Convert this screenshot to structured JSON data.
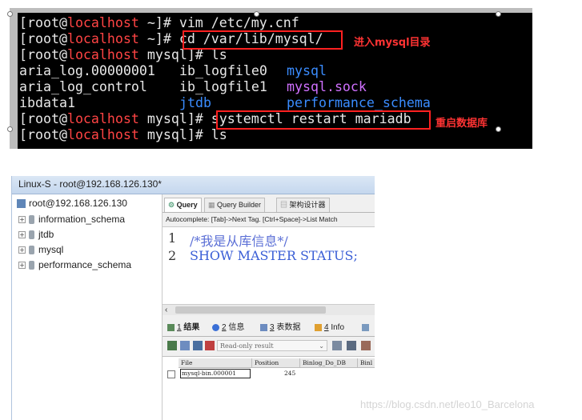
{
  "terminal": {
    "lines": [
      {
        "user": "[root@",
        "host": "localhost",
        "rest": " ~]# vim /etc/my.cnf"
      },
      {
        "user": "[root@",
        "host": "localhost",
        "rest": " ~]# ",
        "cmd": "cd /var/lib/mysql/"
      },
      {
        "user": "[root@",
        "host": "localhost",
        "rest": " mysql]# ls"
      },
      {
        "c1": "aria_log.00000001",
        "c2": "ib_logfile0",
        "c3": "mysql"
      },
      {
        "c1": "aria_log_control",
        "c2": "ib_logfile1",
        "c3": "mysql.sock"
      },
      {
        "c1": "ibdata1",
        "c2": "jtdb",
        "c3": "performance_schema"
      },
      {
        "user": "[root@",
        "host": "localhost",
        "rest": " mysql]# ",
        "cmd": "systemctl restart mariadb"
      },
      {
        "user": "[root@",
        "host": "localhost",
        "rest": " mysql]# ls"
      }
    ],
    "annotation_cd": "进入mysql目录",
    "annotation_restart": "重启数据库"
  },
  "window": {
    "title": "Linux-S - root@192.168.126.130*"
  },
  "tree": {
    "root": "root@192.168.126.130",
    "items": [
      "information_schema",
      "jtdb",
      "mysql",
      "performance_schema"
    ]
  },
  "query_tabs": [
    "Query",
    "Query Builder",
    "架构设计器"
  ],
  "autocomplete": "Autocomplete: [Tab]->Next Tag. [Ctrl+Space]->List Match",
  "editor": {
    "lines": [
      {
        "num": "1",
        "text": "/*我是从库信息*/"
      },
      {
        "num": "2",
        "text": "SHOW MASTER STATUS;"
      }
    ]
  },
  "result_tabs": [
    {
      "num": "1",
      "label": "结果"
    },
    {
      "num": "2",
      "label": "信息"
    },
    {
      "num": "3",
      "label": "表数据"
    },
    {
      "num": "4",
      "label": "Info"
    }
  ],
  "result_mode": "Read-only result",
  "grid": {
    "headers": [
      "File",
      "Position",
      "Binlog_Do_DB",
      "Binl"
    ],
    "row": [
      "mysql-bin.000001",
      "245"
    ]
  },
  "watermark": "https://blog.csdn.net/leo10_Barcelona",
  "colors": {
    "prompt_host": "#ff4444",
    "dir_blue": "#3a8cff",
    "annotation_red": "#ff2020",
    "comment_blue": "#5b6fd6",
    "keyword_blue": "#3a5ed6"
  }
}
